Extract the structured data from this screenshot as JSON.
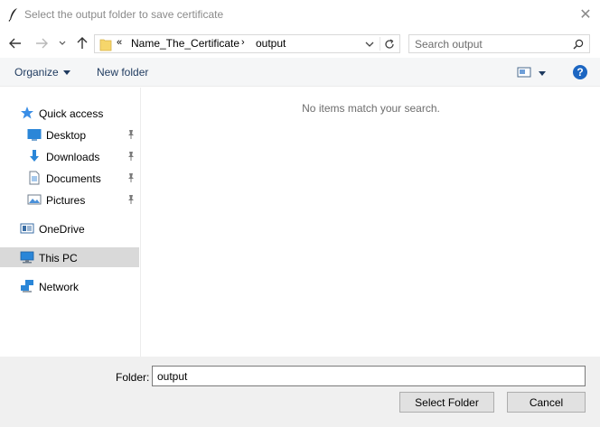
{
  "window": {
    "title": "Select the output folder to save certificate",
    "close_glyph": "✕"
  },
  "navigation": {
    "back_icon": "back-arrow-icon",
    "forward_icon": "forward-arrow-icon",
    "recent_icon": "chevron-down-icon",
    "up_icon": "up-arrow-icon"
  },
  "address": {
    "overflow": "«",
    "path": [
      "Name_The_Certificate",
      "output"
    ],
    "separator": "›"
  },
  "search": {
    "placeholder": "Search output"
  },
  "commands": {
    "organize": "Organize",
    "new_folder": "New folder",
    "help": "?"
  },
  "sidebar": {
    "items": [
      {
        "label": "Quick access",
        "icon": "star-icon",
        "pinned": false
      },
      {
        "label": "Desktop",
        "icon": "desktop-icon",
        "pinned": true
      },
      {
        "label": "Downloads",
        "icon": "download-icon",
        "pinned": true
      },
      {
        "label": "Documents",
        "icon": "document-icon",
        "pinned": true
      },
      {
        "label": "Pictures",
        "icon": "pictures-icon",
        "pinned": true
      },
      {
        "label": "OneDrive",
        "icon": "onedrive-icon",
        "pinned": false
      },
      {
        "label": "This PC",
        "icon": "computer-icon",
        "pinned": false,
        "selected": true
      },
      {
        "label": "Network",
        "icon": "network-icon",
        "pinned": false
      }
    ]
  },
  "content": {
    "empty_message": "No items match your search."
  },
  "footer": {
    "folder_label": "Folder:",
    "folder_value": "output",
    "select_button": "Select Folder",
    "cancel_button": "Cancel"
  },
  "colors": {
    "accent": "#1c66c2",
    "link_text": "#1e3a5f",
    "selected_bg": "#d9d9d9",
    "footer_bg": "#f0f0f0"
  }
}
